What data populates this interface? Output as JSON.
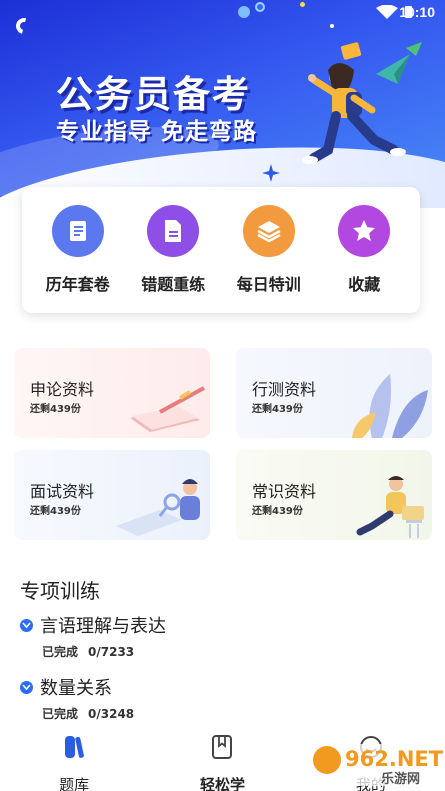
{
  "status_bar": {
    "time": "10:10"
  },
  "hero": {
    "title": "公务员备考",
    "subtitle": "专业指导 免走弯路"
  },
  "quick_menu": [
    {
      "label": "历年套卷",
      "icon": "scroll-icon",
      "color": "#5b78ee"
    },
    {
      "label": "错题重练",
      "icon": "document-icon",
      "color": "#8e4fe6"
    },
    {
      "label": "每日特训",
      "icon": "layers-icon",
      "color": "#f39a3e"
    },
    {
      "label": "收藏",
      "icon": "star-icon",
      "color": "#b348e0"
    }
  ],
  "resources": [
    {
      "title": "申论资料",
      "remaining": "还剩439份"
    },
    {
      "title": "行测资料",
      "remaining": "还剩439份"
    },
    {
      "title": "面试资料",
      "remaining": "还剩439份"
    },
    {
      "title": "常识资料",
      "remaining": "还剩439份"
    }
  ],
  "special_training": {
    "title": "专项训练",
    "items": [
      {
        "name": "言语理解与表达",
        "status": "已完成",
        "progress": "0/7233"
      },
      {
        "name": "数量关系",
        "status": "已完成",
        "progress": "0/3248"
      }
    ]
  },
  "bottom_nav": [
    {
      "label": "题库",
      "icon": "question-bank-icon"
    },
    {
      "label": "轻松学",
      "icon": "book-icon"
    },
    {
      "label": "我的",
      "icon": "profile-icon"
    }
  ],
  "watermark": {
    "text": "962.NET",
    "subtext": "乐游网"
  }
}
